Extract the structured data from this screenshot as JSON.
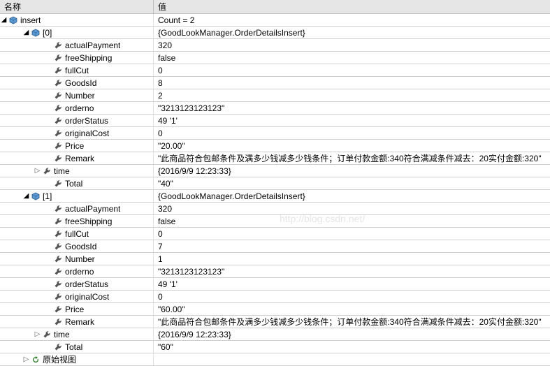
{
  "columns": {
    "name": "名称",
    "value": "值"
  },
  "watermark": "http://blog.csdn.net/",
  "root": {
    "name": "insert",
    "value": "Count = 2",
    "items": [
      {
        "name": "[0]",
        "value": "{GoodLookManager.OrderDetailsInsert}",
        "props": [
          {
            "name": "actualPayment",
            "value": "320"
          },
          {
            "name": "freeShipping",
            "value": "false"
          },
          {
            "name": "fullCut",
            "value": "0"
          },
          {
            "name": "GoodsId",
            "value": "8"
          },
          {
            "name": "Number",
            "value": "2"
          },
          {
            "name": "orderno",
            "value": "\"3213123123123\""
          },
          {
            "name": "orderStatus",
            "value": "49 '1'"
          },
          {
            "name": "originalCost",
            "value": "0"
          },
          {
            "name": "Price",
            "value": "\"20.00\""
          },
          {
            "name": "Remark",
            "value": "\"此商品符合包邮条件及满多少钱减多少钱条件；订单付款金额:340符合满减条件减去：20实付金额:320\""
          },
          {
            "name": "time",
            "value": "{2016/9/9 12:23:33}",
            "expandable": true
          },
          {
            "name": "Total",
            "value": "\"40\""
          }
        ]
      },
      {
        "name": "[1]",
        "value": "{GoodLookManager.OrderDetailsInsert}",
        "props": [
          {
            "name": "actualPayment",
            "value": "320"
          },
          {
            "name": "freeShipping",
            "value": "false"
          },
          {
            "name": "fullCut",
            "value": "0"
          },
          {
            "name": "GoodsId",
            "value": "7"
          },
          {
            "name": "Number",
            "value": "1"
          },
          {
            "name": "orderno",
            "value": "\"3213123123123\""
          },
          {
            "name": "orderStatus",
            "value": "49 '1'"
          },
          {
            "name": "originalCost",
            "value": "0"
          },
          {
            "name": "Price",
            "value": "\"60.00\""
          },
          {
            "name": "Remark",
            "value": "\"此商品符合包邮条件及满多少钱减多少钱条件；订单付款金额:340符合满减条件减去：20实付金额:320\""
          },
          {
            "name": "time",
            "value": "{2016/9/9 12:23:33}",
            "expandable": true
          },
          {
            "name": "Total",
            "value": "\"60\""
          }
        ]
      }
    ]
  },
  "rawView": {
    "label": "原始视图"
  }
}
